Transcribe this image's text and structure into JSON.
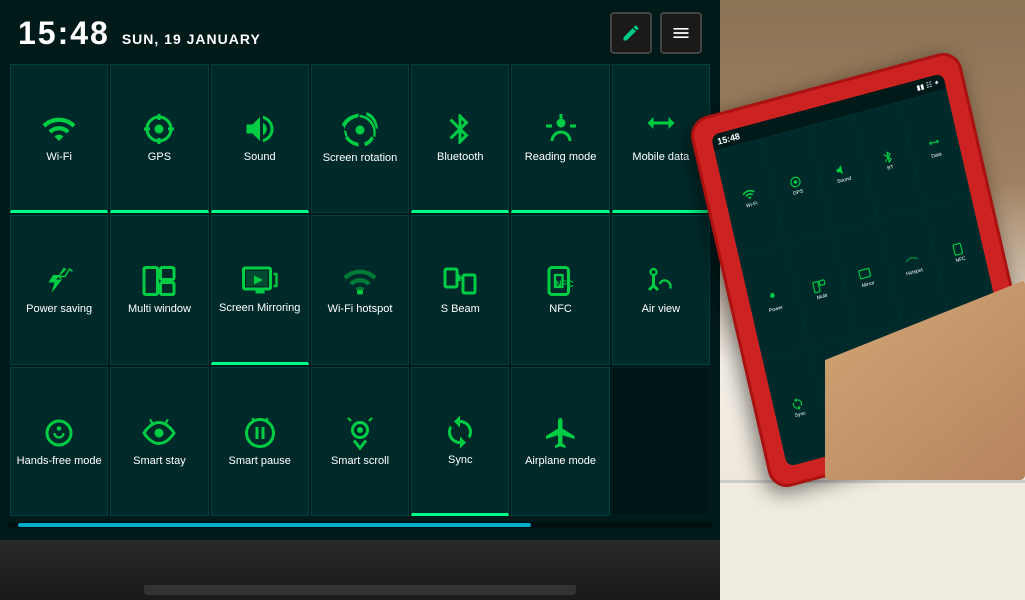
{
  "header": {
    "time": "15:48",
    "date": "SUN, 19 JANUARY",
    "edit_icon": "✏",
    "menu_icon": "≡"
  },
  "grid_rows": [
    [
      {
        "id": "wifi",
        "label": "Wi-Fi",
        "active": true
      },
      {
        "id": "gps",
        "label": "GPS",
        "active": true
      },
      {
        "id": "sound",
        "label": "Sound",
        "active": true
      },
      {
        "id": "screen-rotation",
        "label": "Screen rotation",
        "active": false
      },
      {
        "id": "bluetooth",
        "label": "Bluetooth",
        "active": true
      },
      {
        "id": "reading-mode",
        "label": "Reading mode",
        "active": true
      },
      {
        "id": "mobile-data",
        "label": "Mobile data",
        "active": true
      }
    ],
    [
      {
        "id": "power-saving",
        "label": "Power saving",
        "active": false
      },
      {
        "id": "multi-window",
        "label": "Multi window",
        "active": false
      },
      {
        "id": "screen-mirroring",
        "label": "Screen Mirroring",
        "active": true
      },
      {
        "id": "wifi-hotspot",
        "label": "Wi-Fi hotspot",
        "active": false
      },
      {
        "id": "s-beam",
        "label": "S Beam",
        "active": false
      },
      {
        "id": "nfc",
        "label": "NFC",
        "active": false
      },
      {
        "id": "air-view",
        "label": "Air view",
        "active": false
      }
    ],
    [
      {
        "id": "hands-free",
        "label": "Hands-free mode",
        "active": false
      },
      {
        "id": "smart-stay",
        "label": "Smart stay",
        "active": false
      },
      {
        "id": "smart-pause",
        "label": "Smart pause",
        "active": false
      },
      {
        "id": "smart-scroll",
        "label": "Smart scroll",
        "active": false
      },
      {
        "id": "sync",
        "label": "Sync",
        "active": true
      },
      {
        "id": "airplane",
        "label": "Airplane mode",
        "active": false
      },
      null
    ]
  ],
  "progress": 75,
  "phone": {
    "time": "15:48"
  }
}
